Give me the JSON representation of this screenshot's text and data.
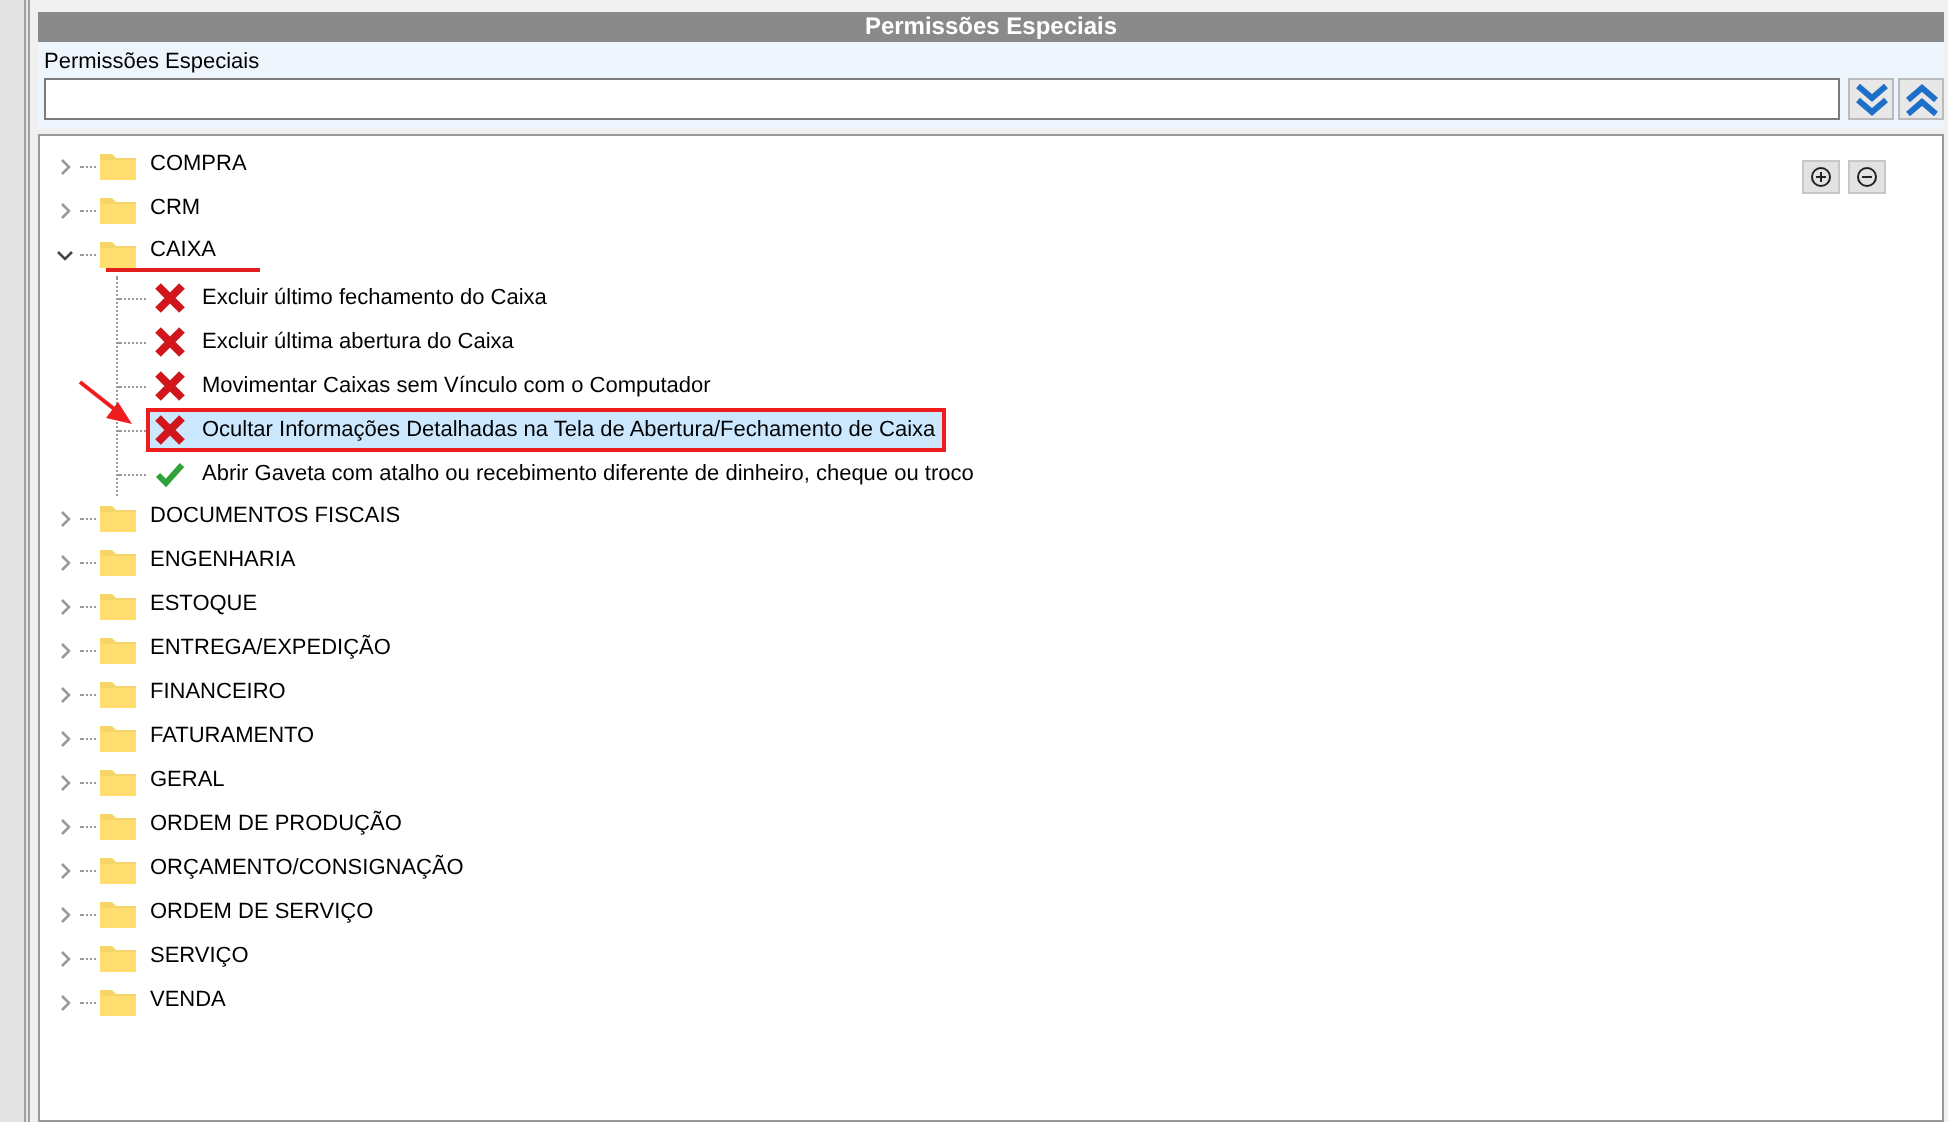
{
  "panel": {
    "title": "Permissões Especiais"
  },
  "filter": {
    "label": "Permissões Especiais"
  },
  "tree": {
    "items": [
      {
        "label": "COMPRA",
        "expanded": false,
        "underlined": false
      },
      {
        "label": "CRM",
        "expanded": false,
        "underlined": false
      },
      {
        "label": "CAIXA",
        "expanded": true,
        "underlined": true,
        "children": [
          {
            "label": "Excluir último fechamento do Caixa",
            "granted": false,
            "selected": false,
            "marked": false
          },
          {
            "label": "Excluir última abertura do Caixa",
            "granted": false,
            "selected": false,
            "marked": false
          },
          {
            "label": "Movimentar Caixas sem Vínculo com o Computador",
            "granted": false,
            "selected": false,
            "marked": false
          },
          {
            "label": "Ocultar Informações Detalhadas na Tela de Abertura/Fechamento de Caixa",
            "granted": false,
            "selected": true,
            "marked": true
          },
          {
            "label": "Abrir Gaveta com atalho ou recebimento diferente de dinheiro, cheque ou troco",
            "granted": true,
            "selected": false,
            "marked": false
          }
        ]
      },
      {
        "label": "DOCUMENTOS FISCAIS",
        "expanded": false,
        "underlined": false
      },
      {
        "label": "ENGENHARIA",
        "expanded": false,
        "underlined": false
      },
      {
        "label": "ESTOQUE",
        "expanded": false,
        "underlined": false
      },
      {
        "label": "ENTREGA/EXPEDIÇÃO",
        "expanded": false,
        "underlined": false
      },
      {
        "label": "FINANCEIRO",
        "expanded": false,
        "underlined": false
      },
      {
        "label": "FATURAMENTO",
        "expanded": false,
        "underlined": false
      },
      {
        "label": "GERAL",
        "expanded": false,
        "underlined": false
      },
      {
        "label": "ORDEM DE PRODUÇÃO",
        "expanded": false,
        "underlined": false
      },
      {
        "label": "ORÇAMENTO/CONSIGNAÇÃO",
        "expanded": false,
        "underlined": false
      },
      {
        "label": "ORDEM DE SERVIÇO",
        "expanded": false,
        "underlined": false
      },
      {
        "label": "SERVIÇO",
        "expanded": false,
        "underlined": false
      },
      {
        "label": "VENDA",
        "expanded": false,
        "underlined": false
      }
    ]
  }
}
